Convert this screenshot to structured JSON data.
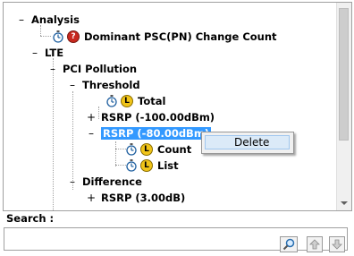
{
  "tree": {
    "items": [
      {
        "label": "Analysis",
        "expander": "–"
      },
      {
        "label": "Dominant PSC(PN) Change Count"
      },
      {
        "label": "LTE",
        "expander": "–"
      },
      {
        "label": "PCI Pollution",
        "expander": "–"
      },
      {
        "label": "Threshold",
        "expander": "–"
      },
      {
        "label": "Total"
      },
      {
        "label": "RSRP (-100.00dBm)",
        "expander": "+"
      },
      {
        "label": "RSRP (-80.00dBm)",
        "expander": "–"
      },
      {
        "label": "Count"
      },
      {
        "label": "List"
      },
      {
        "label": "Difference",
        "expander": "–"
      },
      {
        "label": "RSRP (3.00dB)",
        "expander": "+"
      }
    ]
  },
  "context_menu": {
    "delete_label": "Delete"
  },
  "search": {
    "label": "Search :",
    "value": "",
    "placeholder": ""
  },
  "icons": {
    "timer": "stopwatch-icon",
    "q_badge": "question-badge-icon",
    "l_badge": "L-badge-icon",
    "search": "magnifier-icon",
    "up": "arrow-up-icon",
    "down": "arrow-down-icon"
  },
  "colors": {
    "selection": "#3399ff",
    "menu_hover": "#dbeaf8"
  }
}
